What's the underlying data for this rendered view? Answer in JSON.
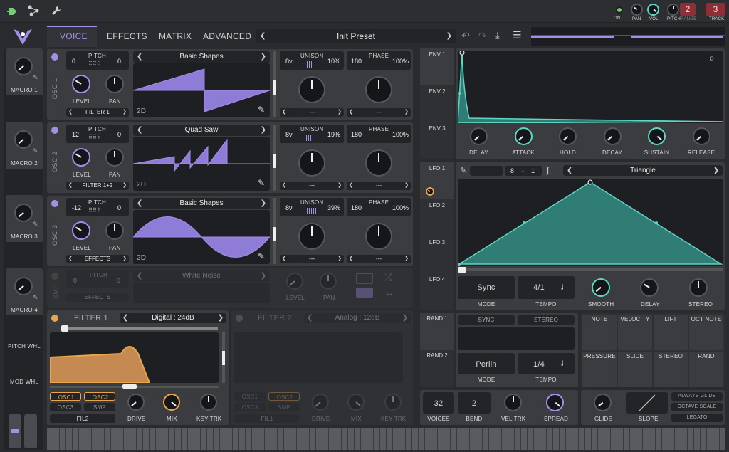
{
  "topbar": {
    "icons": [
      "plug-icon",
      "network-icon",
      "wrench-icon"
    ],
    "status_on": "ON",
    "pan_label": "PAN",
    "vol_label": "VOL",
    "pitch_label": "PITCH",
    "range_label": "RANGE",
    "range_value": "2",
    "track_label": "TRACK",
    "track_value": "3"
  },
  "nav": {
    "tabs": [
      "VOICE",
      "EFFECTS",
      "MATRIX",
      "ADVANCED"
    ],
    "active": "VOICE"
  },
  "preset": {
    "name": "Init Preset"
  },
  "macros": [
    "MACRO 1",
    "MACRO 2",
    "MACRO 3",
    "MACRO 4"
  ],
  "wheels": {
    "pitch": "PITCH WHL",
    "mod": "MOD WHL"
  },
  "oscillators": [
    {
      "name": "OSC 1",
      "pitch_label": "PITCH",
      "transpose": "0",
      "tune": "0",
      "wave": "Basic Shapes",
      "mode": "2D",
      "level": "LEVEL",
      "pan": "PAN",
      "dest": "FILTER 1",
      "voices": "8v",
      "unison": "UNISON",
      "unison_pct": "10%",
      "phase_val": "180",
      "phase": "PHASE",
      "phase_pct": "100%",
      "drop1": "---",
      "drop2": "---"
    },
    {
      "name": "OSC 2",
      "pitch_label": "PITCH",
      "transpose": "12",
      "tune": "0",
      "wave": "Quad Saw",
      "mode": "2D",
      "level": "LEVEL",
      "pan": "PAN",
      "dest": "FILTER 1+2",
      "voices": "8v",
      "unison": "UNISON",
      "unison_pct": "19%",
      "phase_val": "180",
      "phase": "PHASE",
      "phase_pct": "100%",
      "drop1": "---",
      "drop2": "---"
    },
    {
      "name": "OSC 3",
      "pitch_label": "PITCH",
      "transpose": "-12",
      "tune": "0",
      "wave": "Basic Shapes",
      "mode": "2D",
      "level": "LEVEL",
      "pan": "PAN",
      "dest": "EFFECTS",
      "voices": "8v",
      "unison": "UNISON",
      "unison_pct": "39%",
      "phase_val": "180",
      "phase": "PHASE",
      "phase_pct": "100%",
      "drop1": "---",
      "drop2": "---"
    }
  ],
  "sampler": {
    "name": "SMP",
    "pitch_label": "PITCH",
    "transpose": "0",
    "tune": "0",
    "sample": "White Noise",
    "dest": "EFFECTS",
    "level": "LEVEL",
    "pan": "PAN"
  },
  "filter1": {
    "title": "FILTER 1",
    "type": "Digital : 24dB",
    "buttons": [
      "OSC1",
      "OSC2",
      "OSC3",
      "SMP"
    ],
    "fil": "FIL2",
    "knobs": [
      "DRIVE",
      "MIX",
      "KEY TRK"
    ]
  },
  "filter2": {
    "title": "FILTER 2",
    "type": "Analog : 12dB",
    "buttons": [
      "OSC1",
      "OSC2",
      "OSC3",
      "SMP"
    ],
    "fil": "FIL1",
    "knobs": [
      "DRIVE",
      "MIX",
      "KEY TRK"
    ]
  },
  "envelopes": {
    "tabs": [
      "ENV 1",
      "ENV 2",
      "ENV 3"
    ],
    "knobs": [
      "DELAY",
      "ATTACK",
      "HOLD",
      "DECAY",
      "SUSTAIN",
      "RELEASE"
    ]
  },
  "lfos": {
    "tabs": [
      "LFO 1",
      "LFO 2",
      "LFO 3",
      "LFO 4"
    ],
    "grid_a": "8",
    "grid_b": "1",
    "shape": "Triangle",
    "mode_value": "Sync",
    "mode_label": "MODE",
    "tempo_value": "4/1",
    "tempo_label": "TEMPO",
    "knobs": [
      "SMOOTH",
      "DELAY",
      "STEREO"
    ]
  },
  "randoms": {
    "tabs": [
      "RAND 1",
      "RAND 2"
    ],
    "sync": "SYNC",
    "stereo": "STEREO",
    "mode_value": "Perlin",
    "mode_label": "MODE",
    "tempo_value": "1/4",
    "tempo_label": "TEMPO"
  },
  "mod_sources": [
    "NOTE",
    "VELOCITY",
    "LIFT",
    "OCT NOTE",
    "PRESSURE",
    "SLIDE",
    "STEREO",
    "RAND"
  ],
  "voice": {
    "voices_value": "32",
    "voices_label": "VOICES",
    "bend_value": "2",
    "bend_label": "BEND",
    "veltrk": "VEL TRK",
    "spread": "SPREAD"
  },
  "glide": {
    "glide": "GLIDE",
    "slope": "SLOPE",
    "options": [
      "ALWAYS GLIDE",
      "OCTAVE SCALE",
      "LEGATO"
    ]
  },
  "colors": {
    "accent": "#a38ee8",
    "teal": "#5fd6c4",
    "orange": "#e8a54a",
    "panel": "#3b3c40",
    "bg": "#2a2b2f"
  }
}
